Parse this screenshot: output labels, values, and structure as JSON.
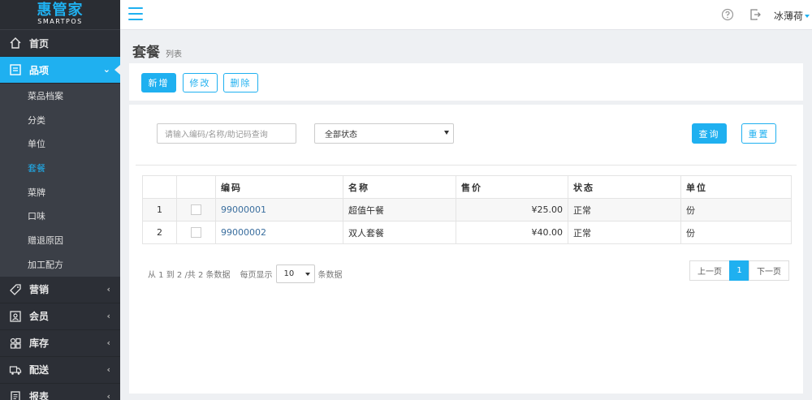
{
  "logo": {
    "main": "惠管家",
    "sub": "SMARTPOS"
  },
  "sidebar": {
    "items": [
      {
        "label": "首页",
        "icon": "home-icon"
      },
      {
        "label": "品项",
        "icon": "list-icon",
        "active": true,
        "children": [
          "菜品档案",
          "分类",
          "单位",
          "套餐",
          "菜牌",
          "口味",
          "赠退原因",
          "加工配方"
        ],
        "current": "套餐"
      },
      {
        "label": "营销",
        "icon": "tag-icon"
      },
      {
        "label": "会员",
        "icon": "member-card-icon"
      },
      {
        "label": "库存",
        "icon": "grid-icon"
      },
      {
        "label": "配送",
        "icon": "truck-icon"
      },
      {
        "label": "报表",
        "icon": "report-icon"
      }
    ]
  },
  "topbar": {
    "user": "冰薄荷",
    "help_icon": "help-circle-icon",
    "exit_icon": "logout-icon"
  },
  "header": {
    "title": "套餐",
    "subtitle": "列表"
  },
  "toolbar": {
    "add": "新增",
    "edit": "修改",
    "delete": "删除"
  },
  "filters": {
    "search_placeholder": "请输入编码/名称/助记码查询",
    "status_value": "全部状态",
    "query": "查询",
    "reset": "重置"
  },
  "table": {
    "headers": [
      "",
      "",
      "编码",
      "名称",
      "售价",
      "状态",
      "单位"
    ],
    "rows": [
      {
        "idx": "1",
        "code": "99000001",
        "name": "超值午餐",
        "price": "¥25.00",
        "status": "正常",
        "unit": "份"
      },
      {
        "idx": "2",
        "code": "99000002",
        "name": "双人套餐",
        "price": "¥40.00",
        "status": "正常",
        "unit": "份"
      }
    ]
  },
  "pagination": {
    "info": "从 1 到 2 /共 2 条数据",
    "per_page_label": "每页显示",
    "per_page_value": "10",
    "per_page_suffix": "条数据",
    "prev": "上一页",
    "current": "1",
    "next": "下一页"
  },
  "colors": {
    "accent": "#1fb0f0",
    "sidebar_bg": "#2c2f36",
    "submenu_bg": "#3b3f47"
  }
}
